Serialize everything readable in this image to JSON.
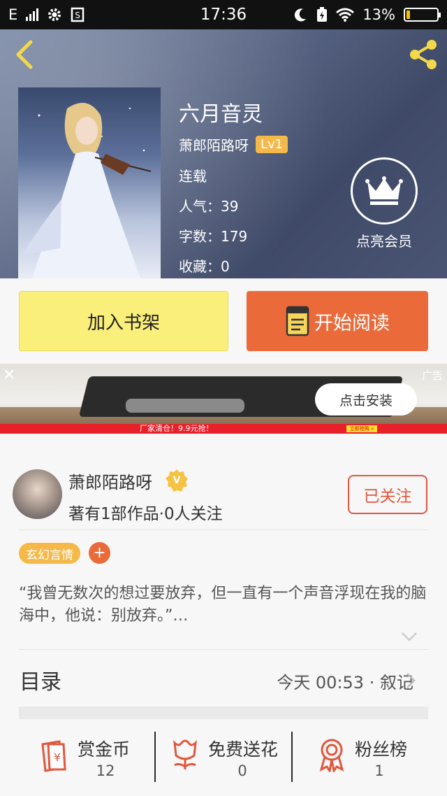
{
  "status_bar": {
    "network": "E",
    "time": "17:36",
    "battery": "13%"
  },
  "book": {
    "title": "六月音灵",
    "author": "萧郎陌路呀",
    "level": "Lv1",
    "status": "连载",
    "popularity_label": "人气",
    "popularity_value": "39",
    "words_label": "字数",
    "words_value": "179",
    "favorites_label": "收藏",
    "favorites_value": "0"
  },
  "vip": {
    "label": "点亮会员"
  },
  "actions": {
    "add_shelf": "加入书架",
    "start_reading": "开始阅读"
  },
  "ad": {
    "close": "✕",
    "tag": "广告",
    "install": "点击安装",
    "strip_text": "厂家清仓！9.9元抢！",
    "strip_button": "立即抢购 »"
  },
  "author_card": {
    "name": "萧郎陌路呀",
    "badge": "V",
    "works": "著有1部作品",
    "followers": "0人关注",
    "follow_button": "已关注"
  },
  "tags": {
    "genre": "玄幻言情",
    "add": "+"
  },
  "intro": "“我曾无数次的想过要放弃，但一直有一个声音浮现在我的脑海中，他说：别放弃。”…",
  "toc": {
    "label": "目录",
    "latest_time": "今天 00:53",
    "separator": "·",
    "latest_chapter": "叙记"
  },
  "stats": [
    {
      "label": "赏金币",
      "value": "12",
      "icon": "reward-coin-icon"
    },
    {
      "label": "免费送花",
      "value": "0",
      "icon": "flower-icon"
    },
    {
      "label": "粉丝榜",
      "value": "1",
      "icon": "medal-icon"
    }
  ],
  "colors": {
    "accent_orange": "#ea6a3a",
    "shelf_yellow": "#fbef7b",
    "badge_yellow": "#f5b94a",
    "follow_red": "#e0573e"
  }
}
